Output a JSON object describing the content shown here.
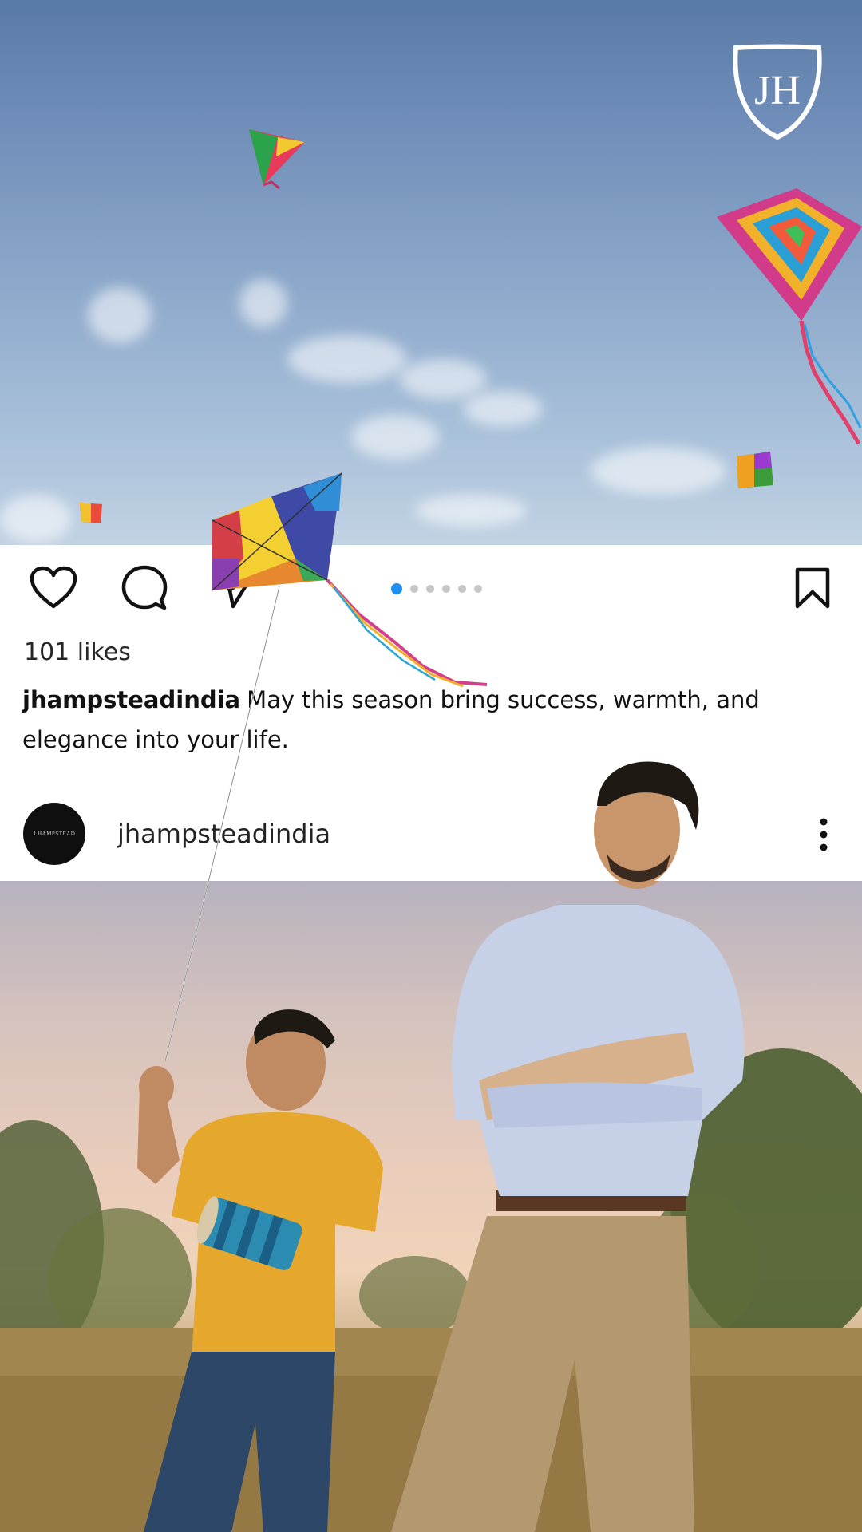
{
  "post": {
    "likes": "101 likes",
    "username": "jhampsteadindia",
    "caption": "May this season bring success, warmth, and elegance into your life.",
    "handle": "jhampsteadindia",
    "avatar_text": "J.HAMPSTEAD",
    "carousel": {
      "count": 6,
      "active_index": 0
    }
  },
  "brand": {
    "logo_letters": "JH"
  },
  "colors": {
    "carousel_active": "#1d8ff0",
    "carousel_inactive": "#c6c6c6",
    "text": "#262626"
  },
  "icons": [
    "heart-icon",
    "comment-icon",
    "share-icon",
    "bookmark-icon",
    "more-vertical-icon"
  ]
}
